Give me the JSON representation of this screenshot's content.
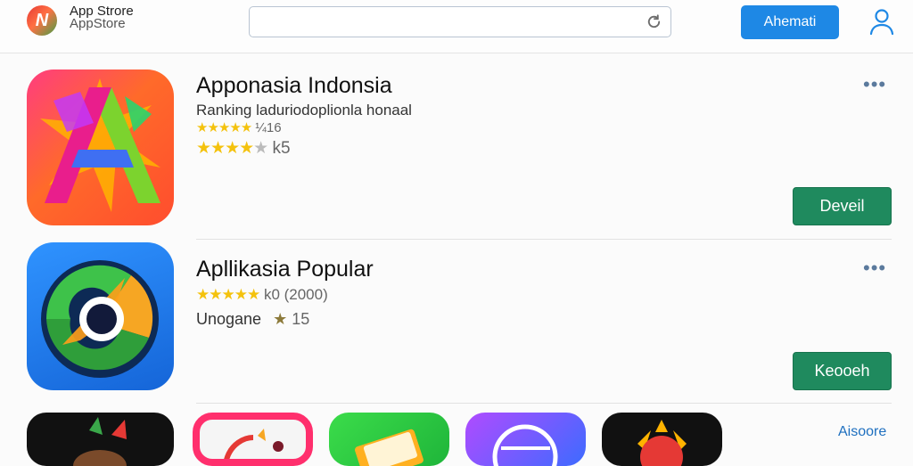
{
  "header": {
    "brand_line1": "App Strore",
    "brand_line2": "AppStore",
    "logo_letter": "N",
    "search_value": "",
    "primary_button": "Ahemati",
    "icons": {
      "logo": "app-logo-icon",
      "refresh": "refresh-icon",
      "user": "user-icon"
    }
  },
  "apps": [
    {
      "title": "Apponasia Indonsia",
      "line1": "Ranking laduriodoplionla honaal",
      "line2_stars": "★★★★★",
      "line2_meta": "¼16",
      "line3_stars": "★★★★",
      "line3_half": "★",
      "line3_meta": "k5",
      "more": "•••",
      "button": "Deveil"
    },
    {
      "title": "Apllikasia Popular",
      "line1_stars": "★★★★★",
      "line1_meta": "k0  (2000)",
      "line2_text": "Unogane",
      "line2_star": "★",
      "line2_meta": "15",
      "more": "•••",
      "button": "Keooeh"
    }
  ],
  "see_all": "Aisoore",
  "colors": {
    "accent": "#1e88e5",
    "green_button": "#1f8a5e",
    "star": "#f4c20d",
    "link": "#1e6fbf"
  }
}
